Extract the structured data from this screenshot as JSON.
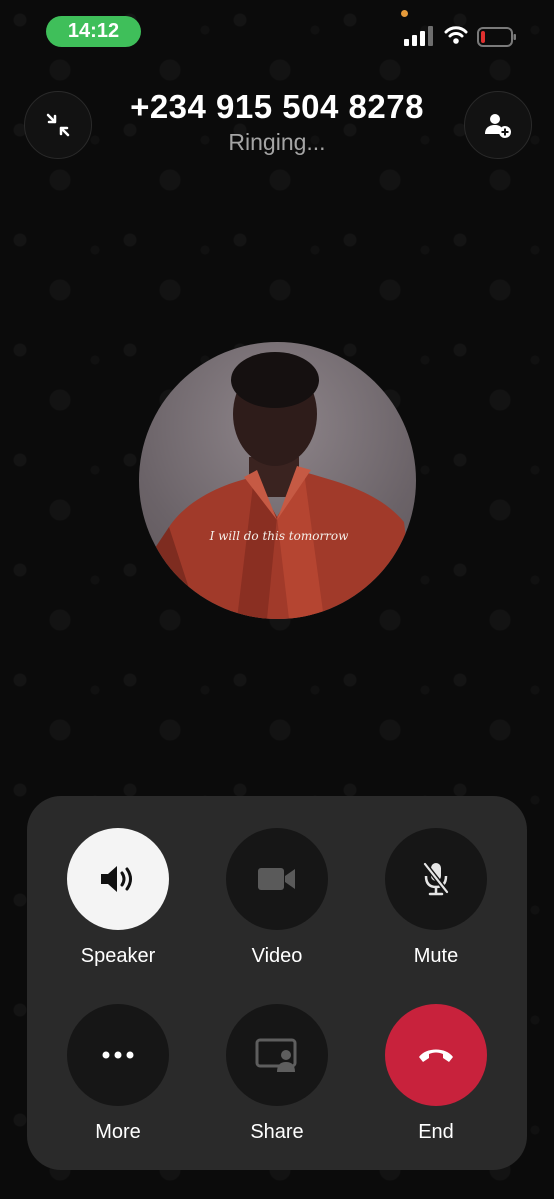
{
  "status_bar": {
    "time": "14:12",
    "icons": [
      "signal-icon",
      "wifi-icon",
      "battery-low-icon"
    ],
    "pill_color": "#3fbf5a",
    "battery_color": "#e0302f"
  },
  "call": {
    "number": "+234 915 504 8278",
    "status": "Ringing...",
    "avatar_caption": "I will do this tomorrow"
  },
  "header": {
    "left_icon": "minimize-icon",
    "right_icon": "add-person-icon"
  },
  "controls": [
    {
      "label": "Speaker",
      "icon": "speaker-icon",
      "active": true
    },
    {
      "label": "Video",
      "icon": "video-icon"
    },
    {
      "label": "Mute",
      "icon": "mic-off-icon"
    },
    {
      "label": "More",
      "icon": "more-icon"
    },
    {
      "label": "Share",
      "icon": "screen-share-icon"
    },
    {
      "label": "End",
      "icon": "end-call-icon",
      "color": "#c8223c"
    }
  ]
}
